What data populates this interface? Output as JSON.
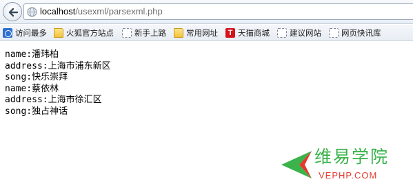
{
  "address_bar": {
    "host": "localhost",
    "path": "/usexml/parsexml.php"
  },
  "bookmarks": [
    {
      "label": "访问最多",
      "icon": "most-visited-icon"
    },
    {
      "label": "火狐官方站点",
      "icon": "folder-icon"
    },
    {
      "label": "新手上路",
      "icon": "dashed-page-icon"
    },
    {
      "label": "常用网址",
      "icon": "folder-icon"
    },
    {
      "label": "天猫商城",
      "icon": "tmall-icon"
    },
    {
      "label": "建议网站",
      "icon": "dashed-page-icon"
    },
    {
      "label": "网页快讯库",
      "icon": "dashed-page-icon"
    }
  ],
  "content": {
    "lines": [
      "name:潘玮柏",
      "address:上海市浦东新区",
      "song:快乐崇拜",
      "name:蔡依林",
      "address:上海市徐汇区",
      "song:独占神话"
    ]
  },
  "watermark": {
    "name_cn": "维易学院",
    "name_en": "VEPHP.COM"
  },
  "colors": {
    "watermark_green": "#39b34a",
    "watermark_red": "#e23a2e",
    "tmall_red": "#d3141b"
  }
}
